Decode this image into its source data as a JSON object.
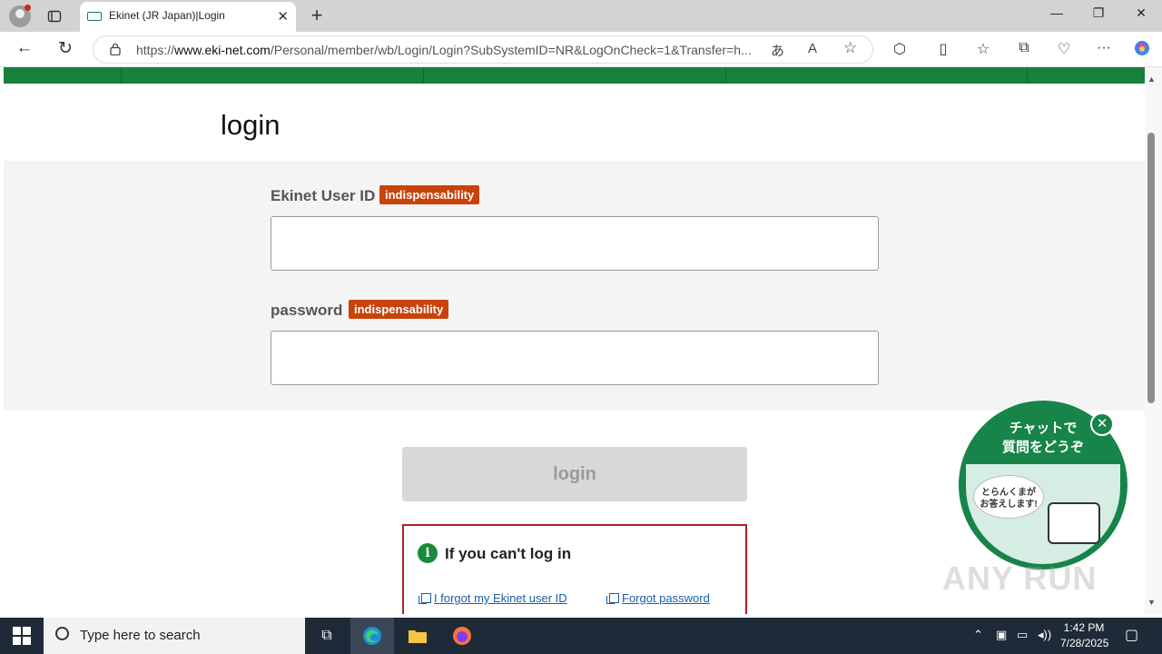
{
  "browser": {
    "tab_title": "Ekinet (JR Japan)|Login",
    "url_prefix": "https://",
    "url_host": "www.eki-net.com",
    "url_path": "/Personal/member/wb/Login/Login?SubSystemID=NR&LogOnCheck=1&Transfer=h..."
  },
  "page": {
    "heading": "login",
    "user_id_label": "Ekinet User ID",
    "password_label": "password",
    "required_badge": "indispensability",
    "user_id_value": "",
    "password_value": "",
    "login_button": "login",
    "help_title": "If you can't log in",
    "help_info_icon": "i",
    "forgot_id_link": "I forgot my Ekinet user ID",
    "forgot_password_link": "Forgot password"
  },
  "chat_widget": {
    "title_line1": "チャットで",
    "title_line2": "質問をどうぞ",
    "bubble_line1": "とらんくまが",
    "bubble_line2": "お答えします!"
  },
  "watermark": "ANY RUN",
  "taskbar": {
    "search_placeholder": "Type here to search",
    "time": "1:42 PM",
    "date": "7/28/2025"
  },
  "colors": {
    "brand_green": "#16803c",
    "required_badge": "#c8430a",
    "help_border": "#b0202a",
    "link": "#1a5fa8"
  }
}
